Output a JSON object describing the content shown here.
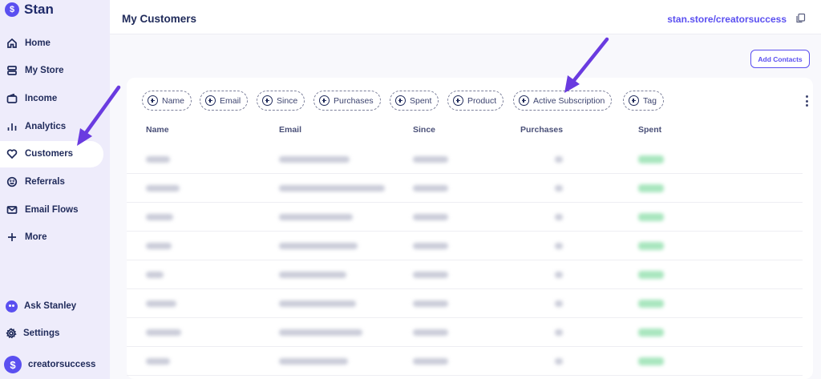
{
  "brand": {
    "name": "Stan",
    "logo_glyph": "$"
  },
  "sidebar": {
    "items": [
      {
        "label": "Home",
        "icon": "home-icon"
      },
      {
        "label": "My Store",
        "icon": "store-icon"
      },
      {
        "label": "Income",
        "icon": "wallet-icon"
      },
      {
        "label": "Analytics",
        "icon": "bar-chart-icon"
      },
      {
        "label": "Customers",
        "icon": "heart-icon",
        "active": true
      },
      {
        "label": "Referrals",
        "icon": "smile-icon"
      },
      {
        "label": "Email Flows",
        "icon": "mail-icon"
      },
      {
        "label": "More",
        "icon": "plus-icon"
      }
    ],
    "bottom": [
      {
        "label": "Ask Stanley",
        "icon": "stanley-icon"
      },
      {
        "label": "Settings",
        "icon": "gear-icon"
      }
    ],
    "profile": {
      "name": "creatorsuccess",
      "avatar_glyph": "$"
    }
  },
  "header": {
    "title": "My Customers",
    "store_link": "stan.store/creatorsuccess",
    "copy_icon": "copy-icon"
  },
  "actions": {
    "add_contacts": "Add Contacts"
  },
  "filters": [
    "Name",
    "Email",
    "Since",
    "Purchases",
    "Spent",
    "Product",
    "Active Subscription",
    "Tag"
  ],
  "table": {
    "columns": [
      "Name",
      "Email",
      "Since",
      "Purchases",
      "Spent"
    ],
    "rows_blurred": 8
  },
  "colors": {
    "accent": "#5a4ff0",
    "sidebar_bg": "#eeecfb",
    "text": "#1f2a5a",
    "arrow": "#6a3be0",
    "spent_badge": "#a8e6be"
  }
}
